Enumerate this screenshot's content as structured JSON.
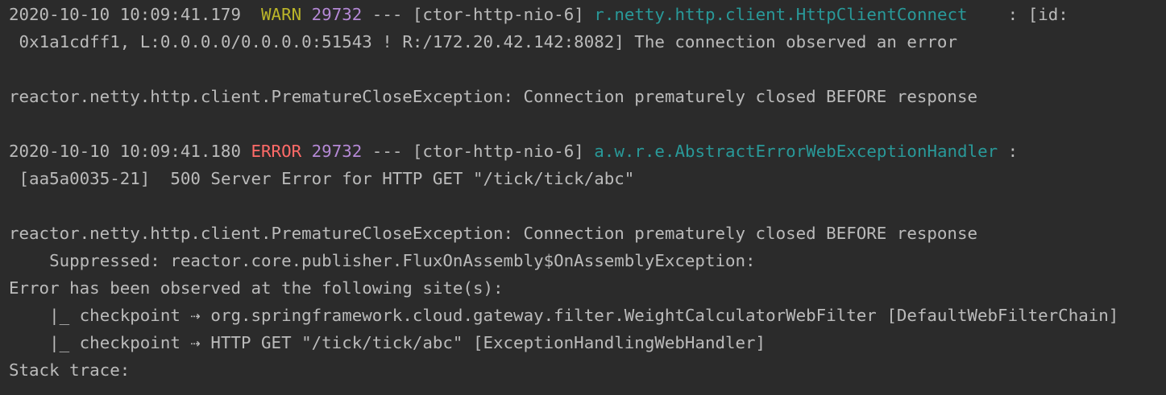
{
  "colors": {
    "background": "#2b2b2b",
    "text": "#bbbbbb",
    "warn": "#bbb529",
    "error": "#ff6b68",
    "pid": "#b589d6",
    "logger": "#299999"
  },
  "entry1": {
    "timestamp": "2020-10-10 10:09:41.179",
    "level": "WARN",
    "pid": "29732",
    "separator": "---",
    "thread": "[ctor-http-nio-6]",
    "logger": "r.netty.http.client.HttpClientConnect",
    "colon_bracket": ": [id:",
    "message_cont": "0x1a1cdff1, L:0.0.0.0/0.0.0.0:51543 ! R:/172.20.42.142:8082] The connection observed an error",
    "exception": "reactor.netty.http.client.PrematureCloseException: Connection prematurely closed BEFORE response"
  },
  "entry2": {
    "timestamp": "2020-10-10 10:09:41.180",
    "level": "ERROR",
    "pid": "29732",
    "separator": "---",
    "thread": "[ctor-http-nio-6]",
    "logger": "a.w.r.e.AbstractErrorWebExceptionHandler",
    "colon": ":",
    "message_cont": "[aa5a0035-21]  500 Server Error for HTTP GET \"/tick/tick/abc\"",
    "exception": "reactor.netty.http.client.PrematureCloseException: Connection prematurely closed BEFORE response",
    "suppressed": "Suppressed: reactor.core.publisher.FluxOnAssembly$OnAssemblyException:",
    "observed": "Error has been observed at the following site(s):",
    "checkpoint1": "|_ checkpoint ⇢ org.springframework.cloud.gateway.filter.WeightCalculatorWebFilter [DefaultWebFilterChain]",
    "checkpoint2": "|_ checkpoint ⇢ HTTP GET \"/tick/tick/abc\" [ExceptionHandlingWebHandler]",
    "stack_trace": "Stack trace:"
  }
}
